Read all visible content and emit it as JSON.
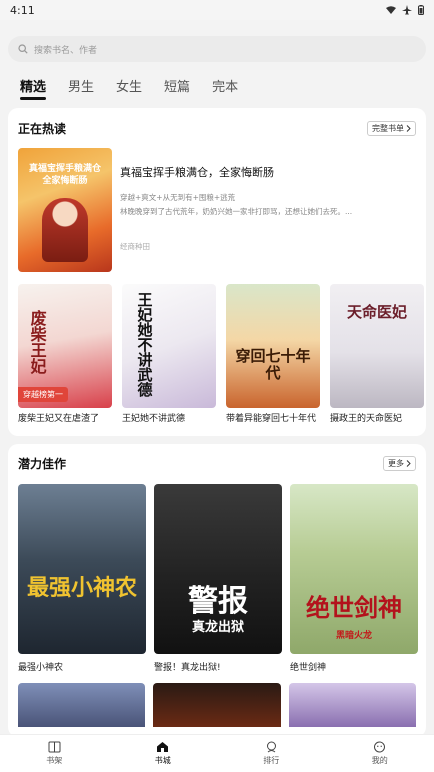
{
  "status_bar": {
    "time": "4:11"
  },
  "search": {
    "placeholder": "搜索书名、作者"
  },
  "tabs": [
    {
      "label": "精选",
      "active": true
    },
    {
      "label": "男生",
      "active": false
    },
    {
      "label": "女生",
      "active": false
    },
    {
      "label": "短篇",
      "active": false
    },
    {
      "label": "完本",
      "active": false
    }
  ],
  "hot_section": {
    "title": "正在热读",
    "more_label": "完整书单",
    "feature": {
      "title": "真福宝挥手粮满仓，全家悔断肠",
      "cover_text": "真福宝挥手粮满仓 全家悔断肠",
      "tags": "穿越+爽文+从无到有+囤粮+逃荒",
      "description": "林晚晚穿到了古代荒年，奶奶兴她一家非打即骂，还想让她们去死。...",
      "author": "经商种田"
    },
    "books": [
      {
        "name": "废柴王妃又在虐渣了",
        "cover_text": "废柴王妃",
        "badge": "穿越榜第一"
      },
      {
        "name": "王妃她不讲武德",
        "cover_text": "王妃她不讲武德"
      },
      {
        "name": "带着异能穿回七十年代",
        "cover_text": "穿回七十年代"
      },
      {
        "name": "摄政王的天命医妃",
        "cover_text": "天命医妃"
      }
    ]
  },
  "potential_section": {
    "title": "潜力佳作",
    "more_label": "更多",
    "books": [
      {
        "name": "最强小神农",
        "cover_text": "最强小神农"
      },
      {
        "name": "警报！真龙出狱!",
        "cover_text": "警报",
        "cover_sub": "真龙出狱"
      },
      {
        "name": "绝世剑神",
        "cover_text": "绝世剑神",
        "cover_sub": "黑暗火龙"
      }
    ]
  },
  "bottom_nav": [
    {
      "label": "书架",
      "icon": "book-icon",
      "active": false
    },
    {
      "label": "书城",
      "icon": "home-icon",
      "active": true
    },
    {
      "label": "排行",
      "icon": "rank-icon",
      "active": false
    },
    {
      "label": "我的",
      "icon": "profile-icon",
      "active": false
    }
  ]
}
